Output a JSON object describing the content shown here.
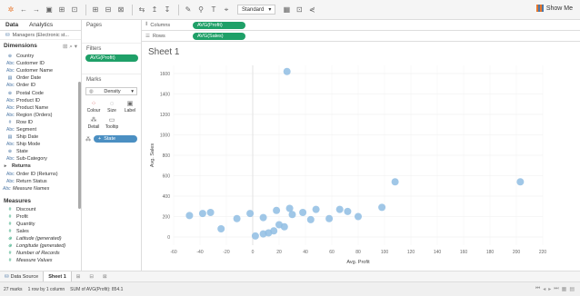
{
  "toolbar": {
    "fit": "Standard",
    "show_me": "Show Me"
  },
  "left": {
    "tabs": [
      "Data",
      "Analytics"
    ],
    "datasource": "Managers (Electronic st...",
    "dimensions_header": "Dimensions",
    "dimensions": [
      {
        "icon": "geo",
        "label": "Country"
      },
      {
        "icon": "abc",
        "label": "Customer ID"
      },
      {
        "icon": "abc",
        "label": "Customer Name"
      },
      {
        "icon": "date",
        "label": "Order Date"
      },
      {
        "icon": "abc",
        "label": "Order ID"
      },
      {
        "icon": "geo",
        "label": "Postal Code"
      },
      {
        "icon": "abc",
        "label": "Product ID"
      },
      {
        "icon": "abc",
        "label": "Product Name"
      },
      {
        "icon": "abc",
        "label": "Region (Orders)"
      },
      {
        "icon": "num",
        "label": "Row ID"
      },
      {
        "icon": "abc",
        "label": "Segment"
      },
      {
        "icon": "date",
        "label": "Ship Date"
      },
      {
        "icon": "abc",
        "label": "Ship Mode"
      },
      {
        "icon": "geo",
        "label": "State"
      },
      {
        "icon": "abc",
        "label": "Sub-Category"
      }
    ],
    "returns_folder": "Returns",
    "returns_items": [
      {
        "icon": "abc",
        "label": "Order ID (Returns)"
      },
      {
        "icon": "abc",
        "label": "Return Status"
      }
    ],
    "measure_names": "Measure Names",
    "measures_header": "Measures",
    "measures": [
      {
        "icon": "#",
        "label": "Discount",
        "italic": false
      },
      {
        "icon": "#",
        "label": "Profit",
        "italic": false
      },
      {
        "icon": "#",
        "label": "Quantity",
        "italic": false
      },
      {
        "icon": "#",
        "label": "Sales",
        "italic": false
      },
      {
        "icon": "geo",
        "label": "Latitude (generated)",
        "italic": true
      },
      {
        "icon": "geo",
        "label": "Longitude (generated)",
        "italic": true
      },
      {
        "icon": "#",
        "label": "Number of Records",
        "italic": true
      },
      {
        "icon": "#",
        "label": "Measure Values",
        "italic": true
      }
    ]
  },
  "mid": {
    "pages": "Pages",
    "filters": "Filters",
    "filter_pill": "AVG(Profit)",
    "marks": "Marks",
    "marks_type": "Density",
    "marks_buttons": [
      {
        "glyph": "⁘",
        "label": "Colour"
      },
      {
        "glyph": "◌",
        "label": "Size"
      },
      {
        "glyph": "▣",
        "label": "Label"
      },
      {
        "glyph": "⁂",
        "label": "Detail"
      },
      {
        "glyph": "▭",
        "label": "Tooltip"
      }
    ],
    "state_pill": "State"
  },
  "shelves": {
    "columns_label": "Columns",
    "columns_pill": "AVG(Profit)",
    "rows_label": "Rows",
    "rows_pill": "AVG(Sales)"
  },
  "sheet_title": "Sheet 1",
  "bottom": {
    "datasource_tab": "Data Source",
    "sheet_tab": "Sheet 1"
  },
  "status": {
    "marks": "27 marks",
    "rows_cols": "1 row by 1 column",
    "sum": "SUM of AVG(Profit): 854.1"
  },
  "colors": {
    "point": "#8fbde3",
    "pill_green": "#1fa068",
    "pill_blue": "#4b8fc2",
    "arrow": "#d62728"
  },
  "chart_data": {
    "type": "scatter",
    "xlabel": "Avg. Profit",
    "ylabel": "Avg. Sales",
    "xlim": [
      -60,
      220
    ],
    "ylim": [
      -80,
      1680
    ],
    "x_ticks": [
      -60,
      -40,
      -20,
      0,
      20,
      40,
      60,
      80,
      100,
      120,
      140,
      160,
      180,
      200,
      220
    ],
    "y_ticks": [
      0,
      200,
      400,
      600,
      800,
      1000,
      1200,
      1400,
      1600
    ],
    "points": [
      [
        26,
        1620
      ],
      [
        108,
        540
      ],
      [
        203,
        540
      ],
      [
        98,
        290
      ],
      [
        -48,
        210
      ],
      [
        -38,
        230
      ],
      [
        -32,
        240
      ],
      [
        -12,
        180
      ],
      [
        -2,
        230
      ],
      [
        8,
        190
      ],
      [
        18,
        260
      ],
      [
        28,
        280
      ],
      [
        38,
        240
      ],
      [
        48,
        270
      ],
      [
        58,
        180
      ],
      [
        66,
        270
      ],
      [
        72,
        250
      ],
      [
        80,
        200
      ],
      [
        -24,
        80
      ],
      [
        2,
        10
      ],
      [
        8,
        30
      ],
      [
        12,
        40
      ],
      [
        16,
        60
      ],
      [
        20,
        120
      ],
      [
        24,
        100
      ],
      [
        30,
        220
      ],
      [
        44,
        170
      ]
    ]
  }
}
